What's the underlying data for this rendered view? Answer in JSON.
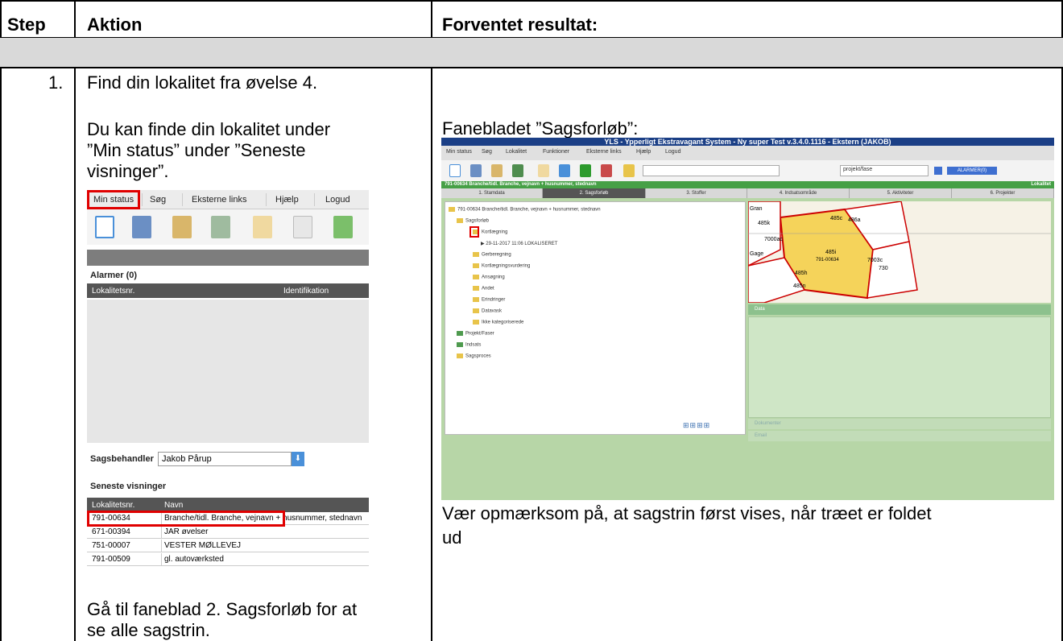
{
  "table": {
    "headers": {
      "step": "Step",
      "action": "Aktion",
      "expected": "Forventet resultat:"
    },
    "row": {
      "step": "1.",
      "action_line1": "Find din lokalitet fra øvelse 4.",
      "action_line2": "Du kan finde din lokalitet under",
      "action_line3": "”Min status” under ”Seneste",
      "action_line4": "visninger”.",
      "action_footer1": "Gå til faneblad 2. Sagsforløb for at",
      "action_footer2": "se alle sagstrin.",
      "expected_caption": "Fanebladet ”Sagsforløb”:",
      "expected_note1": "Vær opmærksom på, at sagstrin først vises, når træet er foldet",
      "expected_note2": "ud"
    }
  },
  "left_screenshot": {
    "menu": [
      "Min status",
      "Søg",
      "Eksterne links",
      "Hjælp",
      "Logud"
    ],
    "alarms_title": "Alarmer (0)",
    "alarm_columns": [
      "Lokalitetsnr.",
      "Identifikation"
    ],
    "caseworker_label": "Sagsbehandler",
    "caseworker_value": "Jakob Pårup",
    "recent_title": "Seneste visninger",
    "recent_columns": [
      "Lokalitetsnr.",
      "Navn"
    ],
    "recent_rows": [
      {
        "nr": "791-00634",
        "name": "Branche/tidl. Branche, vejnavn + husnummer, stednavn"
      },
      {
        "nr": "671-00394",
        "name": "JAR øvelser"
      },
      {
        "nr": "751-00007",
        "name": "VESTER MØLLEVEJ"
      },
      {
        "nr": "791-00509",
        "name": "gl. autoværksted"
      }
    ]
  },
  "right_screenshot": {
    "window_title": "YLS - Ypperligt Ekstravagant System - Ny super Test v.3.4.0.1116 - Ekstern (JAKOB)",
    "menu": [
      "Min status",
      "Søg",
      "Lokalitet",
      "Funktioner",
      "Eksterne links",
      "Hjælp",
      "Logud"
    ],
    "search_value": "projekt/fase",
    "alarm_button": "ALARMER(0)",
    "location_bar": "791-00634 Branche/tidl. Branche, vejnavn + husnummer, stednavn",
    "location_bar_right": "Lokalitet",
    "tabs": [
      "1. Stamdata",
      "2. Sagsforløb",
      "3. Stoffer",
      "4. Indsatsområde",
      "5. Aktiviteter",
      "6. Projekter"
    ],
    "tree": {
      "root": "791-00634 Branche/tidl. Branche, vejnavn + husnummer, stednavn",
      "sagsforloeb": "Sagsforløb",
      "kortlaegning": "Kortlægning",
      "sagstrin": "29-11-2017 11:06 LOKALISERET",
      "children": [
        "Gerberegning",
        "Kortlægningsvurdering",
        "Ansøgning",
        "Andet",
        "Erindringer",
        "Datavask",
        "Ikke kategoriserede"
      ],
      "others": [
        "Projekt/Faser",
        "Indsats",
        "Sagsproces"
      ]
    },
    "map_labels": [
      "485k",
      "7000ac",
      "485c",
      "485i",
      "791-00634",
      "485n",
      "485h",
      "Gran",
      "486a",
      "Gage",
      "7003c",
      "730"
    ],
    "panels": [
      "Data",
      "Dokumenter",
      "Email"
    ]
  }
}
